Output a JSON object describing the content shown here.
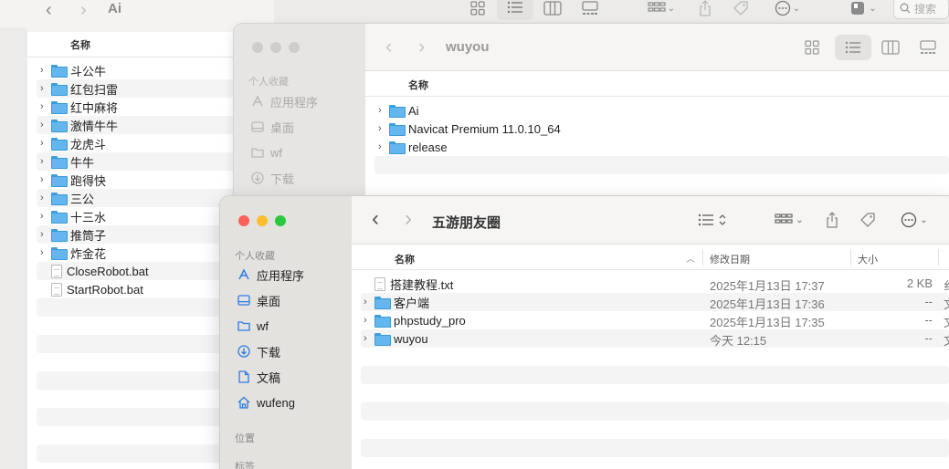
{
  "win1": {
    "title": "Ai",
    "search_placeholder": "搜索",
    "col_name": "名称",
    "items": [
      {
        "name": "斗公牛",
        "kind": "folder"
      },
      {
        "name": "红包扫雷",
        "kind": "folder"
      },
      {
        "name": "红中麻将",
        "kind": "folder"
      },
      {
        "name": "激情牛牛",
        "kind": "folder"
      },
      {
        "name": "龙虎斗",
        "kind": "folder"
      },
      {
        "name": "牛牛",
        "kind": "folder"
      },
      {
        "name": "跑得快",
        "kind": "folder"
      },
      {
        "name": "三公",
        "kind": "folder"
      },
      {
        "name": "十三水",
        "kind": "folder"
      },
      {
        "name": "推筒子",
        "kind": "folder"
      },
      {
        "name": "炸金花",
        "kind": "folder"
      },
      {
        "name": "CloseRobot.bat",
        "kind": "file"
      },
      {
        "name": "StartRobot.bat",
        "kind": "file"
      }
    ]
  },
  "win2": {
    "title": "wuyou",
    "col_name": "名称",
    "sidebar_title": "个人收藏",
    "sidebar": [
      "应用程序",
      "桌面",
      "wf",
      "下载"
    ],
    "items": [
      "Ai",
      "Navicat Premium 11.0.10_64",
      "release"
    ]
  },
  "win3": {
    "title": "五游朋友圈",
    "sidebar_title": "个人收藏",
    "sidebar": [
      "应用程序",
      "桌面",
      "wf",
      "下载",
      "文稿",
      "wufeng"
    ],
    "location_title": "位置",
    "tags_title": "标签",
    "columns": {
      "name": "名称",
      "date": "修改日期",
      "size": "大小"
    },
    "rows": [
      {
        "name": "搭建教程.txt",
        "kind": "file",
        "date": "2025年1月13日 17:37",
        "size": "2 KB",
        "extra": "纟"
      },
      {
        "name": "客户端",
        "kind": "folder",
        "date": "2025年1月13日 17:36",
        "size": "--",
        "extra": "文"
      },
      {
        "name": "phpstudy_pro",
        "kind": "folder",
        "date": "2025年1月13日 17:35",
        "size": "--",
        "extra": "文"
      },
      {
        "name": "wuyou",
        "kind": "folder",
        "date": "今天 12:15",
        "size": "--",
        "extra": "文"
      }
    ]
  },
  "colors": {
    "accent": "#2c7be5",
    "close": "#fe5f57",
    "minimize": "#febc2e",
    "zoom": "#28c840",
    "folder": "#64b7ee"
  }
}
